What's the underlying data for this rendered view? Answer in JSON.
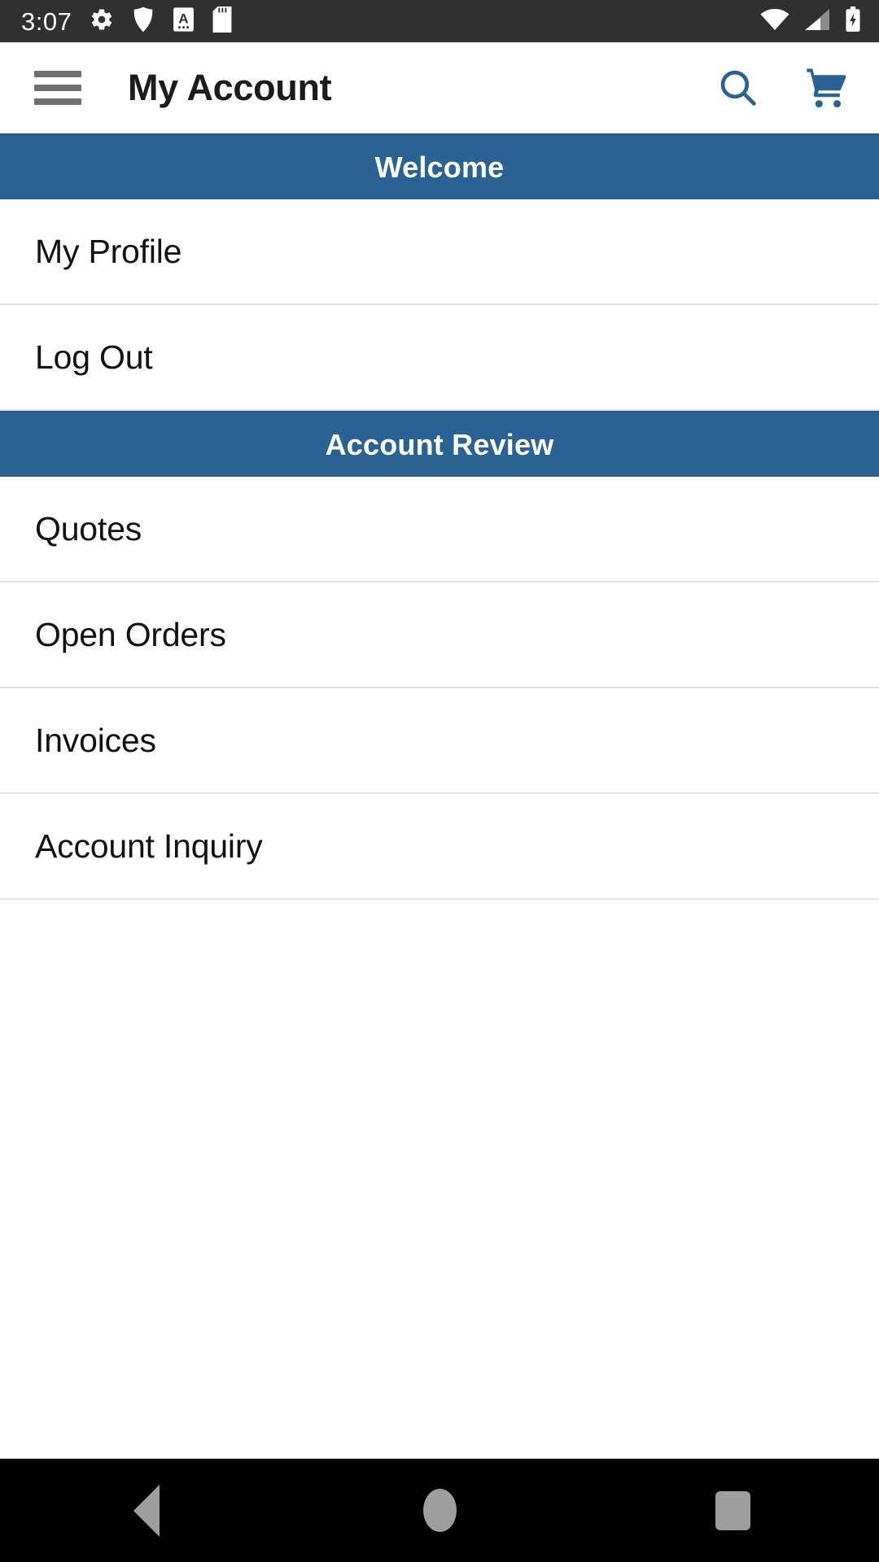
{
  "status_bar": {
    "time": "3:07",
    "left_icons": [
      "gear-icon",
      "shield-icon",
      "letter-a-box-icon",
      "sd-card-icon"
    ],
    "right_icons": [
      "wifi-icon",
      "cellular-signal-icon",
      "battery-charging-icon"
    ],
    "background_color": "#303030",
    "icon_color": "#ffffff"
  },
  "app_bar": {
    "menu_icon": "hamburger-menu-icon",
    "title": "My Account",
    "actions": [
      {
        "name": "search-icon",
        "label": "Search"
      },
      {
        "name": "shopping-cart-icon",
        "label": "Cart"
      }
    ],
    "title_color": "#1c1c1c",
    "action_color": "#2a6293",
    "menu_color": "#707070",
    "background_color": "#ffffff"
  },
  "sections": [
    {
      "header": "Welcome",
      "items": [
        {
          "label": "My Profile"
        },
        {
          "label": "Log Out"
        }
      ]
    },
    {
      "header": "Account Review",
      "items": [
        {
          "label": "Quotes"
        },
        {
          "label": "Open Orders"
        },
        {
          "label": "Invoices"
        },
        {
          "label": "Account Inquiry"
        }
      ]
    }
  ],
  "theme": {
    "accent_blue": "#2a6293",
    "header_text": "#ffffff",
    "row_text": "#121212",
    "divider": "#e2e2e2",
    "page_background": "#ffffff"
  },
  "nav_bar": {
    "background_color": "#000000",
    "icon_color": "#9e9e9e",
    "buttons": [
      {
        "name": "back-button",
        "label": "Back"
      },
      {
        "name": "home-button",
        "label": "Home"
      },
      {
        "name": "recents-button",
        "label": "Recents"
      }
    ]
  }
}
